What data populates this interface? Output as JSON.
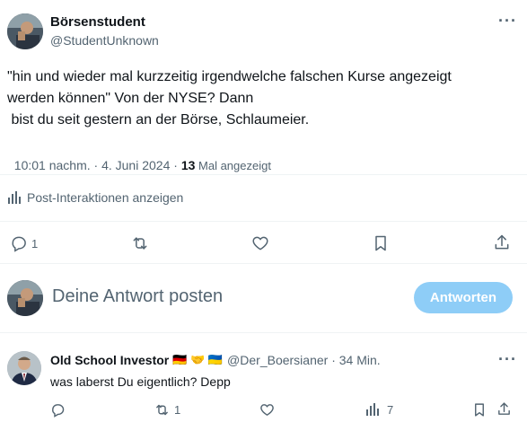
{
  "post": {
    "author_name": "Börsenstudent",
    "author_handle": "@StudentUnknown",
    "more_label": "···",
    "text_line1": "\"hin und wieder mal kurzzeitig irgendwelche falschen Kurse angezeigt",
    "text_line2": "werden können\" Von der NYSE? Dann",
    "text_line3": " bist du seit gestern an der Börse, Schlaumeier.",
    "time": "10:01 nachm.",
    "date_sep": " · ",
    "date": "4. Juni 2024",
    "views_sep": " · ",
    "views_count": "13",
    "views_label": " Mal angezeigt",
    "interactions_label": "Post-Interaktionen anzeigen",
    "actions": {
      "reply_count": "1"
    }
  },
  "compose": {
    "placeholder": "Deine Antwort posten",
    "button_label": "Antworten",
    "button_color": "#8ecdf7"
  },
  "reply": {
    "author_name": "Old School Investor",
    "flags": "🇩🇪 🤝 🇺🇦",
    "author_handle": "@Der_Boersianer",
    "sep": " · ",
    "time": "34 Min.",
    "more_label": "···",
    "text": "was laberst Du eigentlich? Depp",
    "actions": {
      "retweet_count": "1",
      "views_count": "7"
    }
  },
  "colors": {
    "text_primary": "#0f1419",
    "text_secondary": "#536471",
    "divider": "#eff3f4"
  }
}
